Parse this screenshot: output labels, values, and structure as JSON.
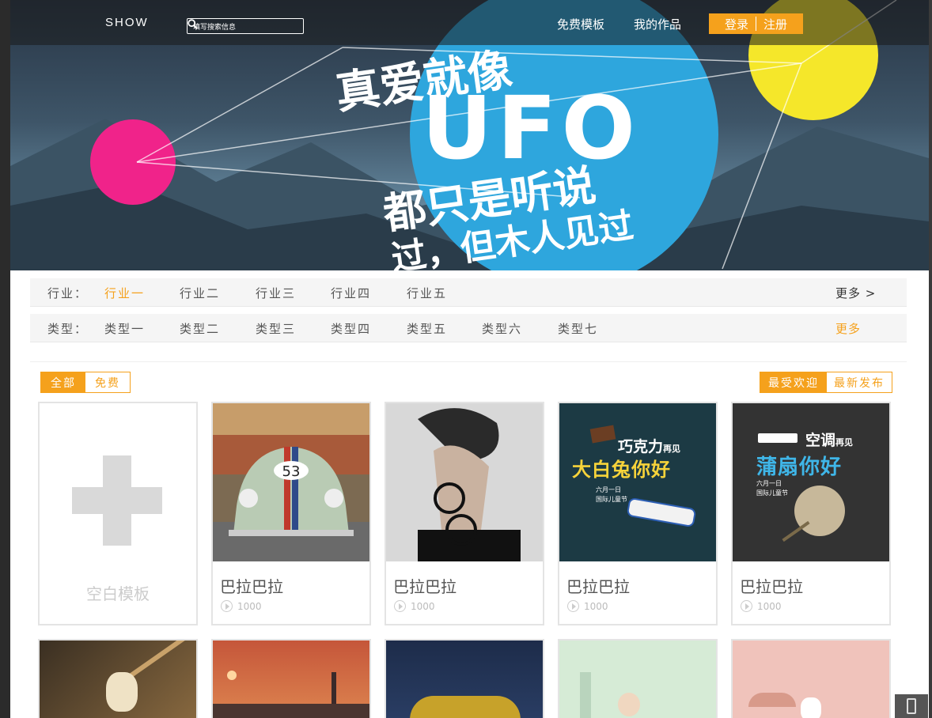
{
  "header": {
    "logo": "SHOW",
    "search_placeholder": "填写搜索信息",
    "nav": [
      "免费模板",
      "我的作品"
    ],
    "login": "登录",
    "register": "注册"
  },
  "banner": {
    "line1": "真爱就像",
    "line2": "UFO",
    "line3": "都只是听说",
    "line4": "过，但木人见过"
  },
  "filters": {
    "industry": {
      "label": "行业：",
      "options": [
        "行业一",
        "行业二",
        "行业三",
        "行业四",
        "行业五"
      ],
      "active_index": 0,
      "more": "更多 >"
    },
    "type": {
      "label": "类型：",
      "options": [
        "类型一",
        "类型二",
        "类型三",
        "类型四",
        "类型五",
        "类型六",
        "类型七"
      ],
      "more": "更多"
    }
  },
  "tabs_left": [
    {
      "label": "全部",
      "active": true
    },
    {
      "label": "免费",
      "active": false
    }
  ],
  "tabs_right": [
    {
      "label": "最受欢迎",
      "active": true
    },
    {
      "label": "最新发布",
      "active": false
    }
  ],
  "blank_template": {
    "label": "空白模板"
  },
  "templates": [
    {
      "title": "巴拉巴拉",
      "views": "1000",
      "image": "vintage-beetle-car"
    },
    {
      "title": "巴拉巴拉",
      "views": "1000",
      "image": "man-with-sunglasses"
    },
    {
      "title": "巴拉巴拉",
      "views": "1000",
      "image": "chocolate-candy-poster",
      "poster": {
        "l1": "巧克力",
        "l1b": "再见",
        "l2": "大白兔你好",
        "l3": "六月一日",
        "l4": "国际儿童节"
      }
    },
    {
      "title": "巴拉巴拉",
      "views": "1000",
      "image": "aircon-fan-poster",
      "poster": {
        "l1": "空调",
        "l1b": "再见",
        "l2": "蒲扇你好",
        "l3": "六月一日",
        "l4": "国际儿童节"
      }
    }
  ],
  "colors": {
    "accent": "#f5a11c",
    "poster_dark": "#1c3a44",
    "poster_gray": "#333333"
  }
}
